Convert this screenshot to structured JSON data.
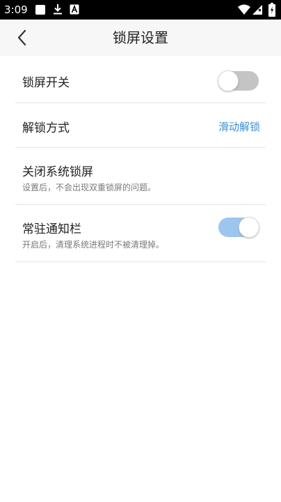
{
  "status_bar": {
    "time": "3:09",
    "icons": [
      "app-square-icon",
      "download-icon",
      "a-badge-icon",
      "wifi-icon",
      "signal-icon",
      "battery-icon"
    ]
  },
  "header": {
    "back_icon": "chevron-left-icon",
    "title": "锁屏设置"
  },
  "settings": {
    "lock_switch": {
      "title": "锁屏开关",
      "enabled": false
    },
    "unlock_mode": {
      "title": "解锁方式",
      "value": "滑动解锁"
    },
    "close_system_lock": {
      "title": "关闭系统锁屏",
      "desc": "设置后，不会出现双重锁屏的问题。"
    },
    "persistent_notification": {
      "title": "常驻通知栏",
      "desc": "开启后，清理系统进程时不被清理掉。",
      "enabled": true
    }
  },
  "colors": {
    "accent": "#3a8fd9",
    "toggle_on": "#9cc6ef",
    "toggle_off": "#c4c4c4",
    "header_bg": "#f7f7f7",
    "status_bar_bg": "#000000"
  }
}
